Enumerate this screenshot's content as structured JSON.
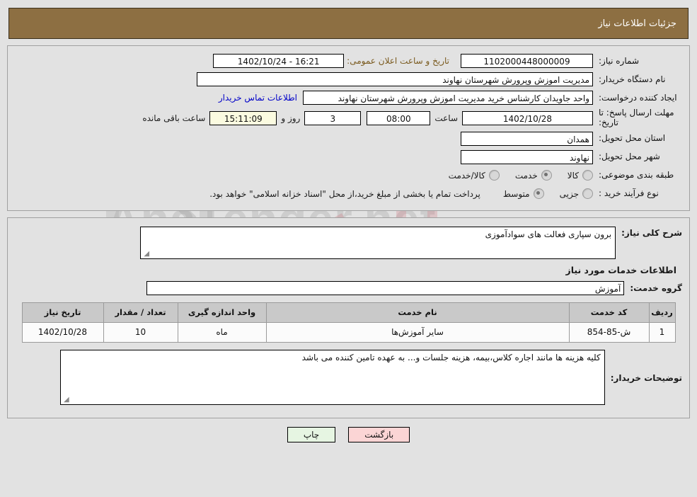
{
  "header": {
    "title": "جزئیات اطلاعات نیاز"
  },
  "form": {
    "need_number_label": "شماره نیاز:",
    "need_number_value": "1102000448000009",
    "public_announce_label": "تاریخ و ساعت اعلان عمومی:",
    "public_announce_value": "16:21 - 1402/10/24",
    "buyer_org_label": "نام دستگاه خریدار:",
    "buyer_org_value": "مدیریت اموزش وپرورش شهرستان نهاوند",
    "requester_label": "ایجاد کننده درخواست:",
    "requester_value": "واحد جاویدان کارشناس خرید  مدیریت اموزش وپرورش شهرستان نهاوند",
    "contact_link": "اطلاعات تماس خریدار",
    "deadline_label": "مهلت ارسال پاسخ: تا تاریخ:",
    "deadline_date": "1402/10/28",
    "hour_label": "ساعت",
    "deadline_time": "08:00",
    "days_value": "3",
    "days_label": "روز و",
    "countdown_value": "15:11:09",
    "remaining_label": "ساعت باقی مانده",
    "province_label": "استان محل تحویل:",
    "province_value": "همدان",
    "city_label": "شهر محل تحویل:",
    "city_value": "نهاوند",
    "category_label": "طبقه بندی موضوعی:",
    "category_options": [
      {
        "label": "کالا",
        "selected": false
      },
      {
        "label": "خدمت",
        "selected": true
      },
      {
        "label": "کالا/خدمت",
        "selected": false
      }
    ],
    "process_label": "نوع فرآیند خرید :",
    "process_options": [
      {
        "label": "جزیی",
        "selected": false
      },
      {
        "label": "متوسط",
        "selected": true
      }
    ],
    "payment_note": "پرداخت تمام یا بخشی از مبلغ خرید،از محل \"اسناد خزانه اسلامی\" خواهد بود."
  },
  "details": {
    "general_label": "شرح کلی نیاز:",
    "general_value": "برون سپاری فعالت های سوادآموزی",
    "services_heading": "اطلاعات خدمات مورد نیاز",
    "service_group_label": "گروه خدمت:",
    "service_group_value": "آموزش",
    "table": {
      "columns": [
        "ردیف",
        "کد خدمت",
        "نام خدمت",
        "واحد اندازه گیری",
        "تعداد / مقدار",
        "تاریخ نیاز"
      ],
      "rows": [
        [
          "1",
          "ش-85-854",
          "سایر آموزش‌ها",
          "ماه",
          "10",
          "1402/10/28"
        ]
      ]
    },
    "notes_label": "توضیحات خریدار:",
    "notes_value": "کلیه هزینه ها مانند اجاره کلاس،بیمه، هزینه جلسات و... به عهده تامین کننده می باشد"
  },
  "footer": {
    "back_label": "بازگشت",
    "print_label": "چاپ"
  },
  "watermark": {
    "text": "AnaTender.net"
  },
  "colors": {
    "header_bg": "#8d6f42",
    "page_bg": "#e2e2e2",
    "link": "#0000c8",
    "accent_brown": "#7a5a1e",
    "back_btn": "#fbd5d5",
    "print_btn": "#e6f5e2"
  }
}
